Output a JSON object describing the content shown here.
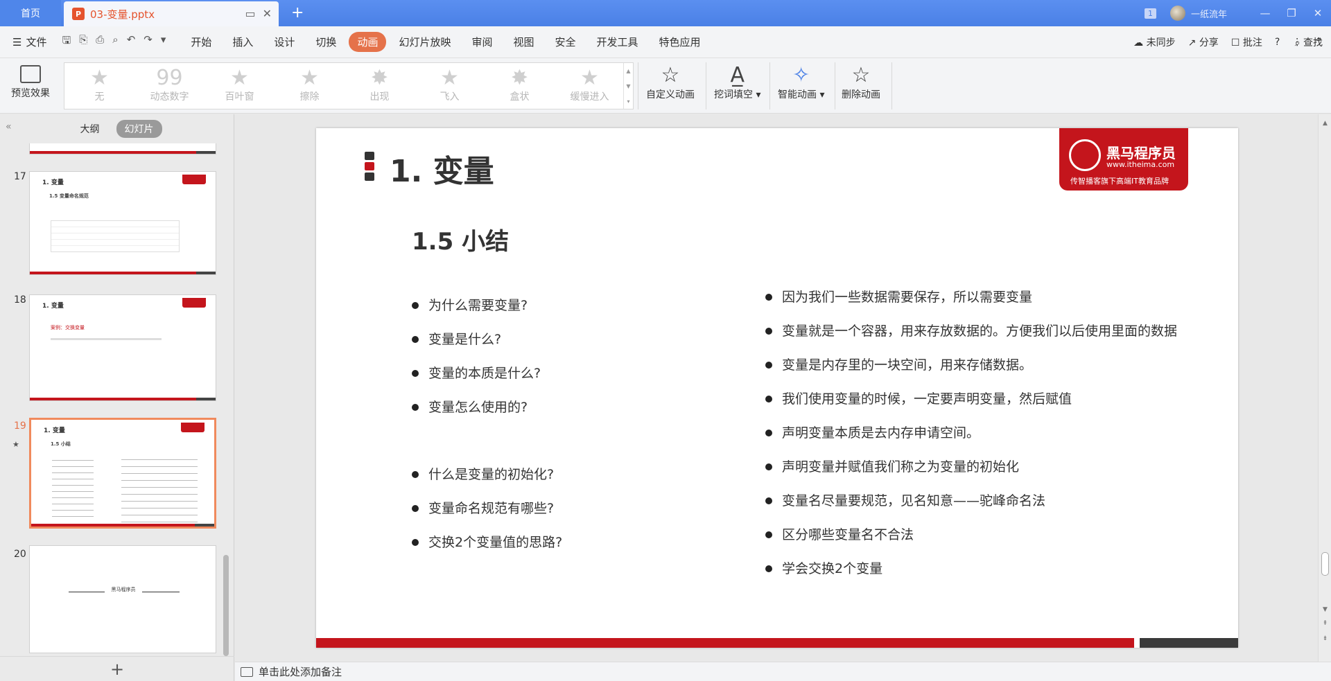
{
  "titlebar": {
    "home_tab": "首页",
    "doc_tab": "03-变量.pptx",
    "doc_badge": "P",
    "add_tab": "+",
    "page_badge": "1",
    "user_name": "一纸流年",
    "window_min": "—",
    "window_max": "❐",
    "window_close": "✕"
  },
  "menubar": {
    "file": "文件",
    "tabs": [
      "开始",
      "插入",
      "设计",
      "切换",
      "动画",
      "幻灯片放映",
      "审阅",
      "视图",
      "安全",
      "开发工具",
      "特色应用"
    ],
    "active_tab": "动画",
    "search": "查找",
    "sync": "未同步",
    "share": "分享",
    "comment": "批注",
    "help": "?",
    "more": "⋮",
    "collapse": "^"
  },
  "ribbon": {
    "preview": "预览效果",
    "gallery": [
      "无",
      "动态数字",
      "百叶窗",
      "擦除",
      "出现",
      "飞入",
      "盒状",
      "缓慢进入"
    ],
    "custom_animation": "自定义动画",
    "cloze": "挖词填空",
    "smart_animation": "智能动画",
    "delete_animation": "删除动画"
  },
  "leftpanel": {
    "tab_outline": "大纲",
    "tab_slides": "幻灯片",
    "add_slide": "+",
    "thumbnails": [
      {
        "num": "17",
        "title": "1. 变量",
        "sub": "1.5 变量命名规范"
      },
      {
        "num": "18",
        "title": "1. 变量",
        "sub": "案例：交换变量"
      },
      {
        "num": "19",
        "title": "1. 变量",
        "sub": "1.5 小结"
      },
      {
        "num": "20",
        "title": "",
        "sub": "黑马程序员"
      }
    ]
  },
  "slide": {
    "title": "1. 变量",
    "subtitle": "1.5 小结",
    "logo_name": "黑马程序员",
    "logo_url": "www.itheima.com",
    "logo_slogan": "传智播客旗下高端IT教育品牌",
    "left_list_a": [
      "为什么需要变量?",
      "变量是什么?",
      "变量的本质是什么?",
      "变量怎么使用的?"
    ],
    "left_list_b": [
      "什么是变量的初始化?",
      "变量命名规范有哪些?",
      "交换2个变量值的思路?"
    ],
    "right_list": [
      "因为我们一些数据需要保存，所以需要变量",
      "变量就是一个容器，用来存放数据的。方便我们以后使用里面的数据",
      "变量是内存里的一块空间，用来存储数据。",
      "我们使用变量的时候，一定要声明变量，然后赋值",
      "声明变量本质是去内存申请空间。",
      "声明变量并赋值我们称之为变量的初始化",
      "变量名尽量要规范，见名知意——驼峰命名法",
      "区分哪些变量名不合法",
      "学会交换2个变量"
    ],
    "colors": {
      "brand_red": "#c4151c",
      "accent": "#e5724a"
    }
  },
  "notes": {
    "placeholder": "单击此处添加备注"
  }
}
